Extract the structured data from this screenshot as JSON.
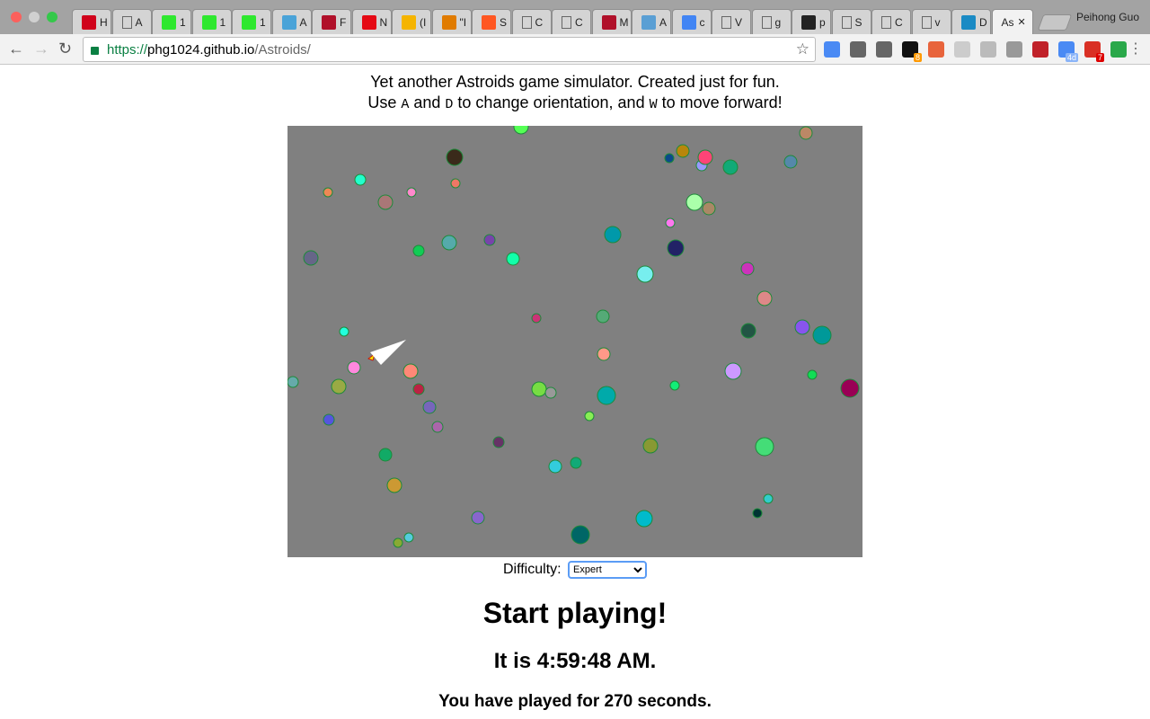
{
  "browser": {
    "profile_name": "Peihong Guo",
    "url_scheme": "https://",
    "url_host": "phg1024.github.io",
    "url_path": "/Astroids/",
    "tabs": [
      {
        "label": "H",
        "icon": "n-icon",
        "color": "#d0021b"
      },
      {
        "label": "A",
        "icon": "page-icon",
        "color": ""
      },
      {
        "label": "1",
        "icon": "smiley-icon",
        "color": "#2ee82e"
      },
      {
        "label": "1",
        "icon": "smiley-icon",
        "color": "#2ee82e"
      },
      {
        "label": "1",
        "icon": "smiley-icon",
        "color": "#2ee82e"
      },
      {
        "label": "A",
        "icon": "diamond-icon",
        "color": "#4aa3d8"
      },
      {
        "label": "F",
        "icon": "oreilly-icon",
        "color": "#b0102a"
      },
      {
        "label": "N",
        "icon": "netflix-icon",
        "color": "#e50914"
      },
      {
        "label": "(I",
        "icon": "n-color-icon",
        "color": "#f5b400"
      },
      {
        "label": "\"I",
        "icon": "bolt-icon",
        "color": "#e07b00"
      },
      {
        "label": "S",
        "icon": "blogger-icon",
        "color": "#ff5722"
      },
      {
        "label": "C",
        "icon": "page-icon",
        "color": ""
      },
      {
        "label": "C",
        "icon": "page-icon",
        "color": ""
      },
      {
        "label": "M",
        "icon": "oreilly-icon",
        "color": "#b0102a"
      },
      {
        "label": "A",
        "icon": "soc-icon",
        "color": "#5a9fd4"
      },
      {
        "label": "c",
        "icon": "google-icon",
        "color": "#4285f4"
      },
      {
        "label": "V",
        "icon": "page-icon",
        "color": ""
      },
      {
        "label": "g",
        "icon": "page-icon",
        "color": ""
      },
      {
        "label": "p",
        "icon": "github-icon",
        "color": "#222222"
      },
      {
        "label": "S",
        "icon": "page-icon",
        "color": ""
      },
      {
        "label": "C",
        "icon": "page-icon",
        "color": ""
      },
      {
        "label": "v",
        "icon": "page-icon",
        "color": ""
      },
      {
        "label": "D",
        "icon": "v-icon",
        "color": "#1a8ac4"
      },
      {
        "label": "As",
        "icon": "",
        "color": ""
      }
    ],
    "extensions": [
      {
        "name": "translate-icon",
        "color": "#4a8af4",
        "badge": ""
      },
      {
        "name": "pocket-icon",
        "color": "#666666",
        "badge": ""
      },
      {
        "name": "inbox-icon",
        "color": "#666666",
        "badge": ""
      },
      {
        "name": "amazon-icon",
        "color": "#111111",
        "badge": "8"
      },
      {
        "name": "bookmark-plus-icon",
        "color": "#e8643c",
        "badge": ""
      },
      {
        "name": "document-icon",
        "color": "#cccccc",
        "badge": ""
      },
      {
        "name": "drive-icon",
        "color": "#bbbbbb",
        "badge": ""
      },
      {
        "name": "jetbrains-icon",
        "color": "#999999",
        "badge": ""
      },
      {
        "name": "sofa-icon",
        "color": "#c0222a",
        "badge": ""
      },
      {
        "name": "calendar-icon",
        "color": "#4a8af4",
        "badge": "4d"
      },
      {
        "name": "gmail-icon",
        "color": "#d93025",
        "badge": "7"
      },
      {
        "name": "check-icon",
        "color": "#2aa84a",
        "badge": ""
      }
    ]
  },
  "page": {
    "intro_line1": "Yet another Astroids game simulator. Created just for fun.",
    "intro_use": "Use ",
    "key_a": "A",
    "intro_and": " and ",
    "key_d": "D",
    "intro_orient": " to change orientation, and ",
    "key_w": "W",
    "intro_forward": " to move forward!",
    "difficulty_label": "Difficulty:",
    "difficulty_value": "Expert",
    "heading": "Start playing!",
    "time_text": "It is 4:59:48 AM.",
    "played_text": "You have played for 270 seconds."
  },
  "game": {
    "background": "#808080",
    "asteroid_stroke": "#1e8a3a",
    "ship_color": "#ffffff",
    "thruster_color": "#f5e100"
  }
}
